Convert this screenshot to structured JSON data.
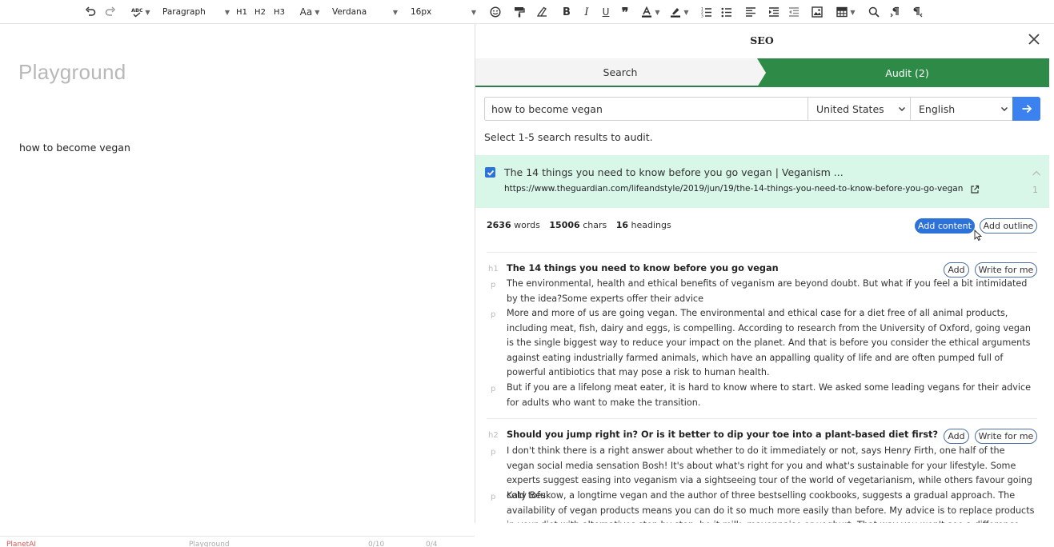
{
  "toolbar": {
    "paragraph_select": "Paragraph",
    "h1": "H1",
    "h2": "H2",
    "h3": "H3",
    "case_label": "Aa",
    "font_family": "Verdana",
    "font_size": "16px"
  },
  "editor": {
    "title_placeholder": "Playground",
    "content": "how to become vegan",
    "status_brand": "PlanetAI",
    "status_doc": "Playground",
    "status_count1": "0/10",
    "status_count2": "0/4"
  },
  "seo_panel": {
    "title": "SEO",
    "tabs": {
      "search": "Search",
      "audit": "Audit (2)"
    },
    "accent_color": "#2e8b47",
    "query": "how to become vegan",
    "country": "United States",
    "language": "English",
    "hint": "Select 1-5 search results to audit.",
    "result": {
      "title": "The 14 things you need to know before you go vegan | Veganism ...",
      "url": "https://www.theguardian.com/lifeandstyle/2019/jun/19/the-14-things-you-need-to-know-before-you-go-vegan",
      "rank": "1",
      "checked": true
    },
    "stats": {
      "words_value": "2636",
      "words_label": "words",
      "chars_value": "15006",
      "chars_label": "chars",
      "headings_value": "16",
      "headings_label": "headings"
    },
    "buttons": {
      "add_content": "Add content",
      "add_outline": "Add outline",
      "add": "Add",
      "write_for_me": "Write for me"
    },
    "sections": [
      {
        "tag": "h1",
        "heading": "The 14 things you need to know before you go vegan",
        "paragraphs": [
          {
            "tag": "p",
            "text": "The environmental, health and ethical benefits of veganism are beyond doubt. But what if you feel a bit intimidated by the idea?Some experts offer their advice"
          },
          {
            "tag": "p",
            "text": "More and more of us are going vegan. The environmental and ethical case for a diet free of all animal products, including meat, fish, dairy and eggs, is compelling. According to research from the University of Oxford, going vegan is the single biggest way to reduce your impact on the planet. And that is before you consider the ethical arguments against eating industrially farmed animals, which have an appalling quality of life and are often pumped full of powerful antibiotics that may pose a risk to human health."
          },
          {
            "tag": "p",
            "text": "But if you are a lifelong meat eater, it is hard to know where to start. We asked some leading vegans for their advice for adults who want to make the transition."
          }
        ]
      },
      {
        "tag": "h2",
        "heading": "Should you jump right in? Or is it better to dip your toe into a plant-based diet first?",
        "paragraphs": [
          {
            "tag": "p",
            "text": "I don't think there is a right answer about whether to do it immediately or not, says Henry Firth, one half of the vegan social media sensation Bosh! It's about what's right for you and what's sustainable for your lifestyle. Some experts suggest easing into veganism via a sightseeing tour of the world of vegetarianism, while others favour going cold tofu."
          },
          {
            "tag": "p",
            "text": "Katy Beskow, a longtime vegan and the author of three bestselling cookbooks, suggests a gradual approach. The availability of vegan products means you can do it so much more easily than before. My advice is to replace products in your diet with alternatives step by step, be it milk, mayonnaise or yoghurt. That way you won't see a difference."
          }
        ]
      }
    ]
  }
}
